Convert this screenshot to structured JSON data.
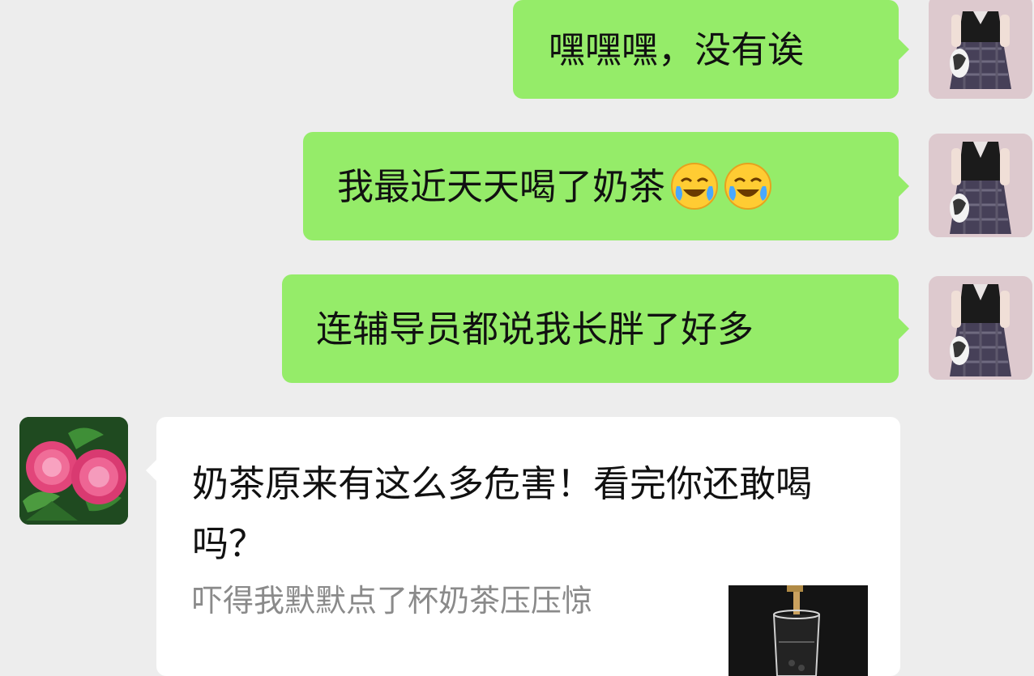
{
  "messages": [
    {
      "sender": "me",
      "text": "嘿嘿嘿，没有诶"
    },
    {
      "sender": "me",
      "text": "我最近天天喝了奶茶",
      "emojis": [
        "laughing-crying-emoji",
        "laughing-crying-emoji"
      ]
    },
    {
      "sender": "me",
      "text": "连辅导员都说我长胖了好多"
    }
  ],
  "link_card": {
    "title": "奶茶原来有这么多危害！看完你还敢喝吗？",
    "description": "吓得我默默点了杯奶茶压压惊",
    "thumbnail": "milk-tea-glass-image"
  },
  "colors": {
    "background": "#ededed",
    "sent_bubble": "#95ec69",
    "received_bubble": "#ffffff",
    "description_text": "#8a8a8a"
  },
  "avatars": {
    "me": "girl-in-uniform-photo",
    "contact": "pink-peony-flowers-photo"
  }
}
